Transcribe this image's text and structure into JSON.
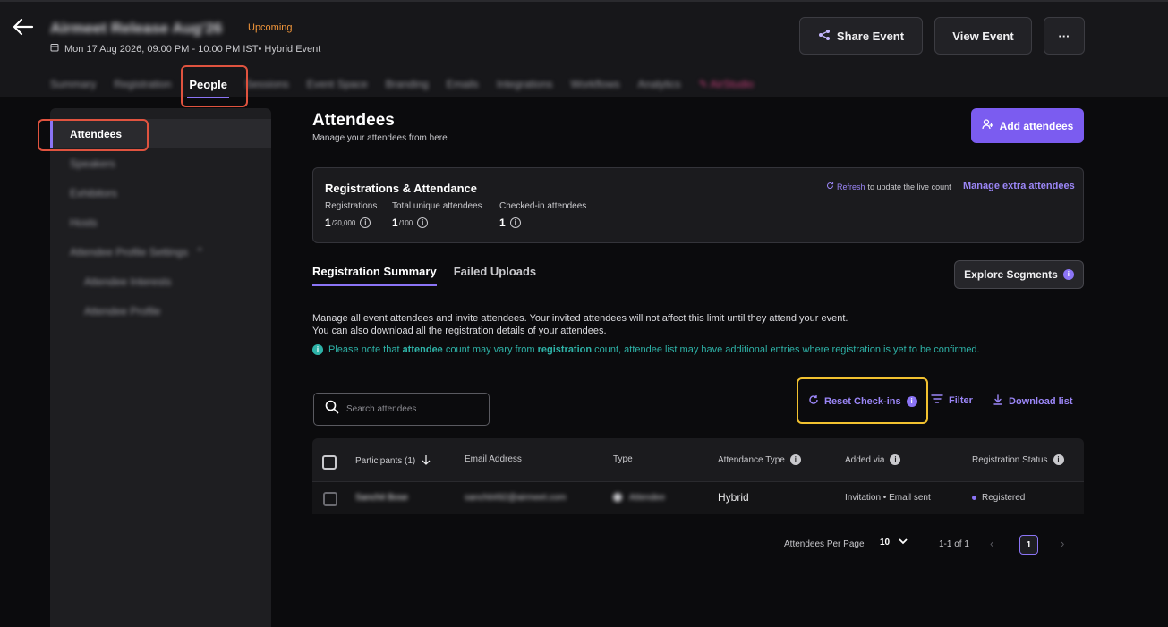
{
  "event": {
    "title": "Airmeet Release Aug'26",
    "status": "Upcoming",
    "datetime": "Mon 17 Aug 2026, 09:00 PM - 10:00 PM IST",
    "type_label": "• Hybrid Event"
  },
  "header": {
    "share_label": "Share Event",
    "view_label": "View Event",
    "more_label": "···"
  },
  "nav": {
    "items": [
      "Summary",
      "Registration",
      "People",
      "Sessions",
      "Event Space",
      "Branding",
      "Emails",
      "Integrations",
      "Workflows",
      "Analytics",
      "✎ AirStudio"
    ],
    "active": "People"
  },
  "sidebar": {
    "items": [
      "Attendees",
      "Speakers",
      "Exhibitors",
      "Hosts",
      "Attendee Profile Settings",
      "Attendee Interests",
      "Attendee Profile"
    ],
    "active": "Attendees"
  },
  "main": {
    "title": "Attendees",
    "subtitle": "Manage your attendees from here",
    "add_label": "Add attendees"
  },
  "stats": {
    "title": "Registrations & Attendance",
    "refresh_link": "Refresh",
    "refresh_text": "to update the live count",
    "manage_link": "Manage extra attendees",
    "registrations_label": "Registrations",
    "registrations_value": "1",
    "registrations_limit": "/20,000",
    "unique_label": "Total unique attendees",
    "unique_value": "1",
    "unique_limit": "/100",
    "checkedin_label": "Checked-in attendees",
    "checkedin_value": "1"
  },
  "tabs": {
    "items": [
      "Registration Summary",
      "Failed Uploads"
    ],
    "active": "Registration Summary",
    "explore_label": "Explore Segments"
  },
  "description": {
    "line1": "Manage all event attendees and invite attendees. Your invited attendees will not affect this limit until they attend your event.",
    "line2": "You can also download all the registration details of your attendees.",
    "note_pre": "Please note that ",
    "note_b1": "attendee",
    "note_mid": " count may vary from ",
    "note_b2": "registration",
    "note_post": " count, attendee list may have additional entries where registration is yet to be confirmed."
  },
  "search": {
    "placeholder": "Search attendees"
  },
  "actions": {
    "reset_label": "Reset Check-ins",
    "filter_label": "Filter",
    "download_label": "Download list"
  },
  "table": {
    "columns": [
      "Participants (1)",
      "Email Address",
      "Type",
      "Attendance Type",
      "Added via",
      "Registration Status"
    ],
    "rows": [
      {
        "name": "Sanchit Bose",
        "email": "sanchit492@airmeet.com",
        "type": "Attendee",
        "attendance": "Hybrid",
        "added_via": "Invitation • Email sent",
        "status": "Registered"
      }
    ]
  },
  "pagination": {
    "per_page_label": "Attendees Per Page",
    "per_page_value": "10",
    "range": "1-1 of 1",
    "current_page": "1"
  },
  "colors": {
    "accent": "#7b5cf0",
    "highlight_red": "#e0533f",
    "highlight_yellow": "#f2c230",
    "note_teal": "#2eb3a8",
    "upcoming_orange": "#f0953a"
  }
}
